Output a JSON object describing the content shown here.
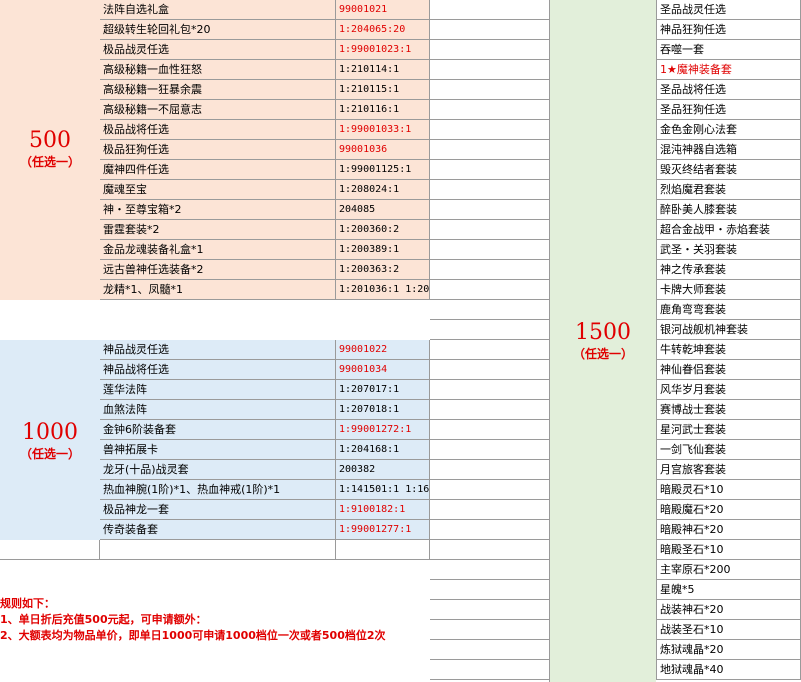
{
  "tier500": {
    "amount": "500",
    "note": "（任选一）",
    "rows": [
      {
        "item": "法阵自选礼盒",
        "code": "99001021",
        "red": true
      },
      {
        "item": "超级转生轮回礼包*20",
        "code": "1:204065:20",
        "red": true
      },
      {
        "item": "极品战灵任选",
        "code": "1:99001023:1",
        "red": true
      },
      {
        "item": "高级秘籍一血性狂怒",
        "code": "1:210114:1",
        "red": false
      },
      {
        "item": "高级秘籍一狂暴余震",
        "code": "1:210115:1",
        "red": false
      },
      {
        "item": "高级秘籍一不屈意志",
        "code": "1:210116:1",
        "red": false
      },
      {
        "item": "极品战将任选",
        "code": "1:99001033:1",
        "red": true
      },
      {
        "item": "极品狂狗任选",
        "code": "99001036",
        "red": true
      },
      {
        "item": "魔神四件任选",
        "code": "1:99001125:1",
        "red": false
      },
      {
        "item": "魔魂至宝",
        "code": "1:208024:1",
        "red": false
      },
      {
        "item": "神・至尊宝箱*2",
        "code": "204085",
        "red": false
      },
      {
        "item": "雷霆套装*2",
        "code": "1:200360:2",
        "red": false
      },
      {
        "item": "金品龙魂装备礼盒*1",
        "code": "1:200389:1",
        "red": false
      },
      {
        "item": "远古兽神任选装备*2",
        "code": "1:200363:2",
        "red": false
      },
      {
        "item": "龙精*1、凤髓*1",
        "code": "1:201036:1    1:201037:1",
        "red": false
      }
    ]
  },
  "tier1000": {
    "amount": "1000",
    "note": "（任选一）",
    "rows": [
      {
        "item": "神品战灵任选",
        "code": "99001022",
        "red": true
      },
      {
        "item": "神品战将任选",
        "code": "99001034",
        "red": true
      },
      {
        "item": "莲华法阵",
        "code": "1:207017:1",
        "red": false
      },
      {
        "item": "血煞法阵",
        "code": "1:207018:1",
        "red": false
      },
      {
        "item": "金钟6阶装备套",
        "code": "1:99001272:1",
        "red": true
      },
      {
        "item": "兽神拓展卡",
        "code": "1:204168:1",
        "red": false
      },
      {
        "item": "龙牙(十品)战灵套",
        "code": "200382",
        "red": false
      },
      {
        "item": "热血神腕(1阶)*1、热血神戒(1阶)*1",
        "code": "1:141501:1  1:161501:1",
        "red": false
      },
      {
        "item": "极品神龙一套",
        "code": "1:9100182:1",
        "red": true
      },
      {
        "item": "传奇装备套",
        "code": "1:99001277:1",
        "red": true
      }
    ]
  },
  "tier1500": {
    "amount": "1500",
    "note": "（任选一）",
    "items": [
      {
        "text": "圣品战灵任选",
        "red": false
      },
      {
        "text": "神品狂狗任选",
        "red": false
      },
      {
        "text": "吞噬一套",
        "red": false
      },
      {
        "text": "1★魔神装备套",
        "red": true
      },
      {
        "text": "圣品战将任选",
        "red": false
      },
      {
        "text": "圣品狂狗任选",
        "red": false
      },
      {
        "text": "金色金刚心法套",
        "red": false
      },
      {
        "text": "混沌神器自选箱",
        "red": false
      },
      {
        "text": "毁灭终结者套装",
        "red": false
      },
      {
        "text": "烈焰魔君套装",
        "red": false
      },
      {
        "text": "醉卧美人膝套装",
        "red": false
      },
      {
        "text": "超合金战甲・赤焰套装",
        "red": false
      },
      {
        "text": "武圣・关羽套装",
        "red": false
      },
      {
        "text": "神之传承套装",
        "red": false
      },
      {
        "text": "卡牌大师套装",
        "red": false
      },
      {
        "text": "鹿角弯弯套装",
        "red": false
      },
      {
        "text": "银河战舰机神套装",
        "red": false
      },
      {
        "text": "牛转乾坤套装",
        "red": false
      },
      {
        "text": "神仙眷侣套装",
        "red": false
      },
      {
        "text": "风华岁月套装",
        "red": false
      },
      {
        "text": "赛博战士套装",
        "red": false
      },
      {
        "text": "星河武士套装",
        "red": false
      },
      {
        "text": "一剑飞仙套装",
        "red": false
      },
      {
        "text": "月宫旅客套装",
        "red": false
      },
      {
        "text": "暗殿灵石*10",
        "red": false
      },
      {
        "text": "暗殿魔石*20",
        "red": false
      },
      {
        "text": "暗殿神石*20",
        "red": false
      },
      {
        "text": "暗殿圣石*10",
        "red": false
      },
      {
        "text": "主宰原石*200",
        "red": false
      },
      {
        "text": "星魄*5",
        "red": false
      },
      {
        "text": "战装神石*20",
        "red": false
      },
      {
        "text": "战装圣石*10",
        "red": false
      },
      {
        "text": "炼狱魂晶*20",
        "red": false
      },
      {
        "text": "地狱魂晶*40",
        "red": false
      }
    ]
  },
  "rules": {
    "title": "规则如下：",
    "lines": [
      "1、单日折后充值500元起，可申请额外：",
      "2、大额表均为物品单价，即单日1000可申请1000档位一次或者500档位2次"
    ]
  },
  "colors": {
    "peach": "#fce4d6",
    "blue": "#ddebf7",
    "green": "#e2efda",
    "red": "#e00000",
    "grid": "#9a9a9a"
  }
}
